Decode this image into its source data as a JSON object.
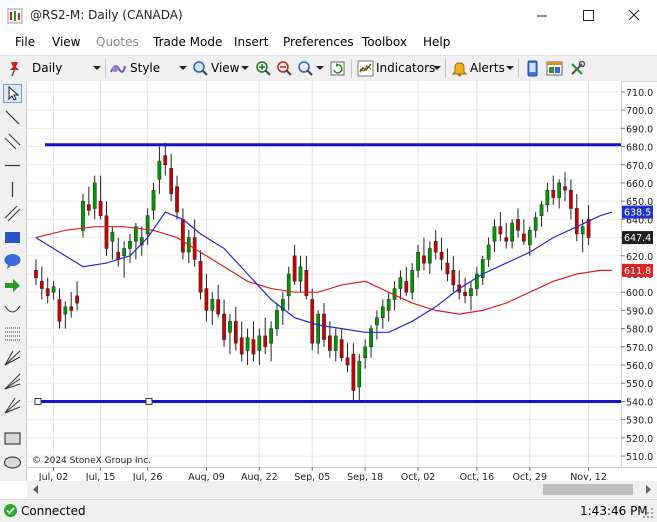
{
  "window": {
    "title": "@RS2-M: Daily (CANADA)"
  },
  "menu": [
    "File",
    "View",
    "Quotes",
    "Trade Mode",
    "Insert",
    "Preferences",
    "Toolbox",
    "Help"
  ],
  "menu_disabled": [
    "Quotes"
  ],
  "toolbar": {
    "interval": "Daily",
    "style_label": "Style",
    "view_label": "View",
    "indicators_label": "Indicators",
    "alerts_label": "Alerts"
  },
  "status": {
    "connection": "Connected",
    "time": "1:43:46 PM"
  },
  "colors": {
    "hline": "#1414c8",
    "ma_fast": "#2828d2",
    "ma_slow": "#e02020",
    "last_price": "#1f1f1f",
    "ma_fast_label_bg": "#2233cc",
    "ma_slow_label_bg": "#dd2222",
    "up_candle": "#009900",
    "down_candle": "#cc0000"
  },
  "chart_data": {
    "type": "candlestick",
    "copyright": "© 2024 StoneX Group Inc.",
    "y_ticks": [
      "710.0",
      "700.0",
      "690.0",
      "680.0",
      "670.0",
      "660.0",
      "650.0",
      "640.0",
      "630.0",
      "620.0",
      "610.0",
      "600.0",
      "590.0",
      "580.0",
      "570.0",
      "560.0",
      "550.0",
      "540.0",
      "530.0",
      "520.0",
      "510.0"
    ],
    "ylim": [
      504,
      716
    ],
    "x_ticks": [
      {
        "label": "Jul, 02",
        "i": 3
      },
      {
        "label": "Jul, 15",
        "i": 11
      },
      {
        "label": "Jul, 26",
        "i": 19
      },
      {
        "label": "Aug, 09",
        "i": 29
      },
      {
        "label": "Aug, 22",
        "i": 38
      },
      {
        "label": "Sep, 05",
        "i": 47
      },
      {
        "label": "Sep, 18",
        "i": 56
      },
      {
        "label": "Oct, 02",
        "i": 65
      },
      {
        "label": "Oct, 16",
        "i": 75
      },
      {
        "label": "Oct, 29",
        "i": 84
      },
      {
        "label": "Nov, 12",
        "i": 94
      }
    ],
    "x_count": 99,
    "horizontal_lines": [
      681,
      540
    ],
    "last_price_label": "647.4",
    "ma_fast_label": "638.5",
    "ma_slow_label": "611.8",
    "ohlc": [
      [
        612,
        618,
        604,
        608
      ],
      [
        606,
        614,
        596,
        602
      ],
      [
        602,
        608,
        594,
        598
      ],
      [
        600,
        606,
        596,
        603
      ],
      [
        596,
        602,
        580,
        584
      ],
      [
        588,
        595,
        580,
        592
      ],
      [
        592,
        600,
        586,
        590
      ],
      [
        598,
        606,
        590,
        594
      ],
      [
        634,
        654,
        630,
        650
      ],
      [
        648,
        658,
        642,
        645
      ],
      [
        646,
        664,
        640,
        660
      ],
      [
        650,
        664,
        640,
        642
      ],
      [
        642,
        650,
        620,
        624
      ],
      [
        628,
        636,
        618,
        633
      ],
      [
        622,
        630,
        614,
        618
      ],
      [
        620,
        628,
        608,
        624
      ],
      [
        624,
        632,
        616,
        628
      ],
      [
        628,
        638,
        618,
        636
      ],
      [
        626,
        636,
        620,
        630
      ],
      [
        632,
        646,
        626,
        642
      ],
      [
        645,
        660,
        640,
        656
      ],
      [
        662,
        680,
        654,
        672
      ],
      [
        675,
        682,
        664,
        670
      ],
      [
        668,
        676,
        650,
        654
      ],
      [
        658,
        664,
        640,
        644
      ],
      [
        640,
        646,
        618,
        622
      ],
      [
        622,
        634,
        616,
        630
      ],
      [
        630,
        640,
        614,
        618
      ],
      [
        617,
        623,
        596,
        600
      ],
      [
        602,
        610,
        584,
        590
      ],
      [
        590,
        600,
        582,
        596
      ],
      [
        596,
        604,
        586,
        588
      ],
      [
        588,
        596,
        570,
        574
      ],
      [
        578,
        588,
        566,
        584
      ],
      [
        584,
        592,
        568,
        572
      ],
      [
        575,
        584,
        562,
        566
      ],
      [
        568,
        580,
        560,
        575
      ],
      [
        574,
        584,
        562,
        566
      ],
      [
        568,
        580,
        560,
        576
      ],
      [
        576,
        586,
        566,
        570
      ],
      [
        572,
        584,
        562,
        580
      ],
      [
        580,
        594,
        576,
        590
      ],
      [
        590,
        600,
        582,
        596
      ],
      [
        598,
        614,
        590,
        610
      ],
      [
        620,
        626,
        604,
        606
      ],
      [
        606,
        620,
        600,
        614
      ],
      [
        612,
        620,
        596,
        598
      ],
      [
        596,
        602,
        568,
        572
      ],
      [
        572,
        590,
        566,
        588
      ],
      [
        588,
        594,
        570,
        574
      ],
      [
        576,
        584,
        564,
        568
      ],
      [
        568,
        580,
        562,
        576
      ],
      [
        574,
        580,
        562,
        564
      ],
      [
        564,
        572,
        556,
        560
      ],
      [
        566,
        572,
        540,
        546
      ],
      [
        548,
        566,
        540,
        562
      ],
      [
        564,
        574,
        558,
        570
      ],
      [
        570,
        582,
        564,
        580
      ],
      [
        582,
        590,
        574,
        586
      ],
      [
        586,
        596,
        580,
        592
      ],
      [
        590,
        600,
        584,
        596
      ],
      [
        596,
        606,
        590,
        602
      ],
      [
        602,
        612,
        596,
        608
      ],
      [
        606,
        614,
        598,
        600
      ],
      [
        600,
        616,
        596,
        612
      ],
      [
        612,
        626,
        608,
        622
      ],
      [
        620,
        630,
        612,
        616
      ],
      [
        616,
        628,
        610,
        624
      ],
      [
        628,
        634,
        618,
        622
      ],
      [
        622,
        630,
        612,
        618
      ],
      [
        616,
        624,
        606,
        610
      ],
      [
        612,
        620,
        600,
        604
      ],
      [
        604,
        612,
        596,
        600
      ],
      [
        600,
        608,
        594,
        598
      ],
      [
        598,
        606,
        590,
        602
      ],
      [
        602,
        614,
        598,
        610
      ],
      [
        608,
        620,
        604,
        618
      ],
      [
        618,
        630,
        614,
        626
      ],
      [
        628,
        640,
        622,
        636
      ],
      [
        636,
        644,
        628,
        632
      ],
      [
        630,
        638,
        624,
        628
      ],
      [
        628,
        640,
        624,
        638
      ],
      [
        640,
        646,
        630,
        634
      ],
      [
        632,
        640,
        626,
        628
      ],
      [
        626,
        636,
        620,
        634
      ],
      [
        634,
        644,
        630,
        641
      ],
      [
        642,
        650,
        636,
        648
      ],
      [
        648,
        660,
        644,
        656
      ],
      [
        656,
        664,
        648,
        652
      ],
      [
        652,
        662,
        646,
        660
      ],
      [
        658,
        666,
        650,
        656
      ],
      [
        656,
        662,
        640,
        646
      ],
      [
        646,
        654,
        628,
        632
      ],
      [
        632,
        640,
        622,
        636
      ],
      [
        640,
        648,
        626,
        630
      ]
    ],
    "ma_fast": [
      [
        0,
        630
      ],
      [
        4,
        622
      ],
      [
        8,
        614
      ],
      [
        12,
        616
      ],
      [
        16,
        620
      ],
      [
        19,
        630
      ],
      [
        22,
        644
      ],
      [
        25,
        640
      ],
      [
        28,
        632
      ],
      [
        32,
        624
      ],
      [
        36,
        610
      ],
      [
        40,
        596
      ],
      [
        44,
        586
      ],
      [
        48,
        582
      ],
      [
        52,
        580
      ],
      [
        56,
        578
      ],
      [
        60,
        578
      ],
      [
        64,
        584
      ],
      [
        68,
        592
      ],
      [
        72,
        602
      ],
      [
        76,
        610
      ],
      [
        80,
        616
      ],
      [
        84,
        622
      ],
      [
        88,
        630
      ],
      [
        92,
        636
      ],
      [
        96,
        642
      ],
      [
        98,
        644
      ]
    ],
    "ma_slow": [
      [
        0,
        630
      ],
      [
        5,
        634
      ],
      [
        10,
        636
      ],
      [
        15,
        636
      ],
      [
        20,
        634
      ],
      [
        24,
        630
      ],
      [
        28,
        622
      ],
      [
        32,
        614
      ],
      [
        36,
        606
      ],
      [
        40,
        602
      ],
      [
        44,
        600
      ],
      [
        48,
        600
      ],
      [
        52,
        604
      ],
      [
        56,
        606
      ],
      [
        60,
        600
      ],
      [
        64,
        594
      ],
      [
        68,
        590
      ],
      [
        72,
        588
      ],
      [
        76,
        590
      ],
      [
        80,
        594
      ],
      [
        84,
        600
      ],
      [
        88,
        606
      ],
      [
        92,
        610
      ],
      [
        96,
        612
      ],
      [
        98,
        612
      ]
    ]
  }
}
